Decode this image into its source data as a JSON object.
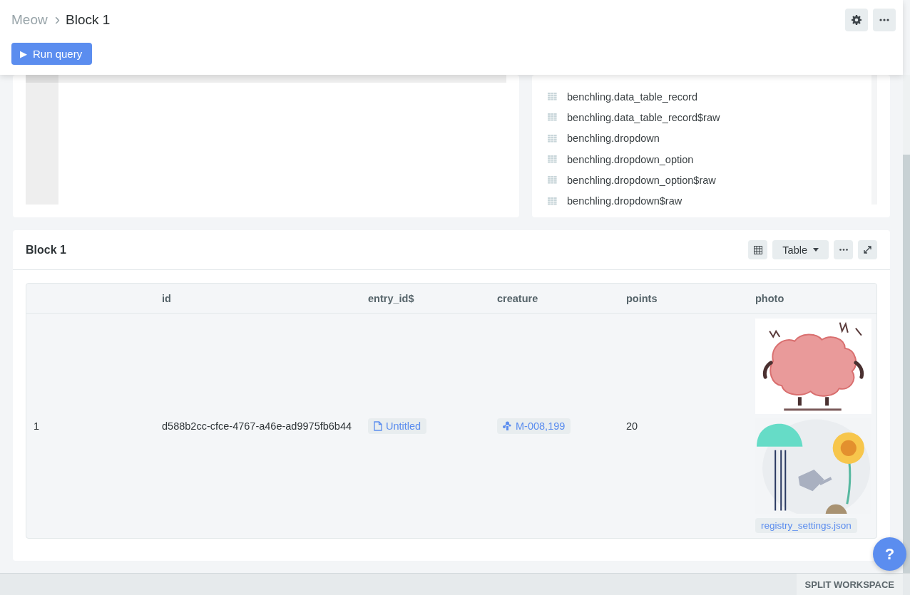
{
  "breadcrumb": {
    "parent": "Meow",
    "separator": "›",
    "current": "Block 1"
  },
  "run_button": {
    "icon": "▶",
    "label": "Run query"
  },
  "schema": {
    "tables": [
      "benchling.data_table_record",
      "benchling.data_table_record$raw",
      "benchling.dropdown",
      "benchling.dropdown_option",
      "benchling.dropdown_option$raw",
      "benchling.dropdown$raw"
    ]
  },
  "block": {
    "title": "Block 1",
    "view": "Table",
    "columns": [
      "",
      "id",
      "entry_id$",
      "creature",
      "points",
      "photo"
    ],
    "rows": [
      {
        "index": "1",
        "id": "d588b2cc-cfce-4767-a46e-ad9975fb6b44",
        "entry": "Untitled",
        "creature": "M-008,199",
        "points": "20",
        "file": "registry_settings.json"
      }
    ]
  },
  "help_button": "?",
  "footer": {
    "button": "SPLIT WORKSPACE"
  }
}
